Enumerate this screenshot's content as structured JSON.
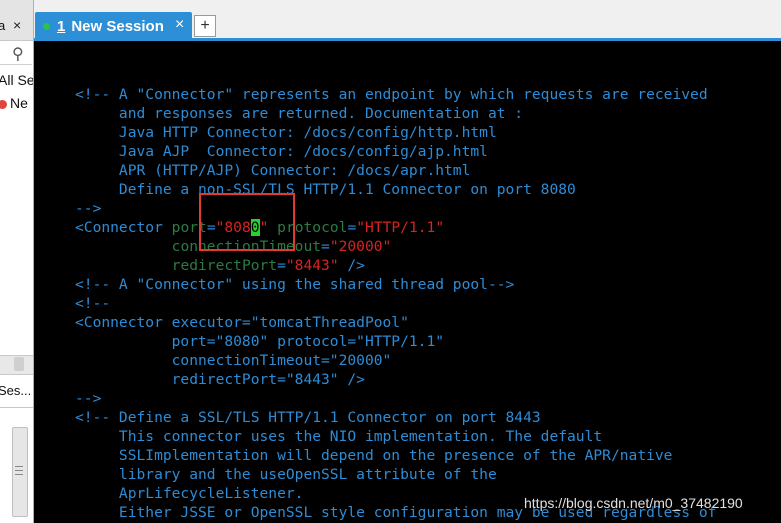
{
  "left_panel": {
    "top_text": "a",
    "close_glyph": "×",
    "items": [
      {
        "label": "All Se"
      },
      {
        "label": "Ne"
      }
    ],
    "sessions_label": "Ses..."
  },
  "tabs": {
    "active": {
      "number": "1",
      "label": "New Session",
      "close_glyph": "×"
    },
    "add_glyph": "+"
  },
  "terminal": {
    "lines": [
      {
        "segments": [
          {
            "cls": "c",
            "text": "<!-- A \"Connector\" represents an endpoint by which requests are received"
          }
        ]
      },
      {
        "segments": [
          {
            "cls": "c",
            "text": "     and responses are returned. Documentation at :"
          }
        ]
      },
      {
        "segments": [
          {
            "cls": "c",
            "text": "     Java HTTP Connector: /docs/config/http.html"
          }
        ]
      },
      {
        "segments": [
          {
            "cls": "c",
            "text": "     Java AJP  Connector: /docs/config/ajp.html"
          }
        ]
      },
      {
        "segments": [
          {
            "cls": "c",
            "text": "     APR (HTTP/AJP) Connector: /docs/apr.html"
          }
        ]
      },
      {
        "segments": [
          {
            "cls": "c",
            "text": "     Define a non-SSL/TLS HTTP/1.1 Connector on port 8080"
          }
        ]
      },
      {
        "segments": [
          {
            "cls": "c",
            "text": "-->"
          }
        ]
      },
      {
        "segments": [
          {
            "cls": "t",
            "text": "<Connector "
          },
          {
            "cls": "a",
            "text": "port"
          },
          {
            "cls": "t",
            "text": "="
          },
          {
            "cls": "v",
            "text": "\"808"
          },
          {
            "cls": "cursor",
            "text": "0"
          },
          {
            "cls": "v",
            "text": "\""
          },
          {
            "cls": "t",
            "text": " "
          },
          {
            "cls": "a",
            "text": "protocol"
          },
          {
            "cls": "t",
            "text": "="
          },
          {
            "cls": "v",
            "text": "\"HTTP/1.1\""
          }
        ]
      },
      {
        "segments": [
          {
            "cls": "t",
            "text": "           "
          },
          {
            "cls": "a",
            "text": "connectionTimeout"
          },
          {
            "cls": "t",
            "text": "="
          },
          {
            "cls": "v",
            "text": "\"20000\""
          }
        ]
      },
      {
        "segments": [
          {
            "cls": "t",
            "text": "           "
          },
          {
            "cls": "a",
            "text": "redirectPort"
          },
          {
            "cls": "t",
            "text": "="
          },
          {
            "cls": "v",
            "text": "\"8443\""
          },
          {
            "cls": "t",
            "text": " />"
          }
        ]
      },
      {
        "segments": [
          {
            "cls": "c",
            "text": "<!-- A \"Connector\" using the shared thread pool-->"
          }
        ]
      },
      {
        "segments": [
          {
            "cls": "c",
            "text": "<!--"
          }
        ]
      },
      {
        "segments": [
          {
            "cls": "c",
            "text": "<Connector executor=\"tomcatThreadPool\""
          }
        ]
      },
      {
        "segments": [
          {
            "cls": "c",
            "text": "           port=\"8080\" protocol=\"HTTP/1.1\""
          }
        ]
      },
      {
        "segments": [
          {
            "cls": "c",
            "text": "           connectionTimeout=\"20000\""
          }
        ]
      },
      {
        "segments": [
          {
            "cls": "c",
            "text": "           redirectPort=\"8443\" />"
          }
        ]
      },
      {
        "segments": [
          {
            "cls": "c",
            "text": "-->"
          }
        ]
      },
      {
        "segments": [
          {
            "cls": "c",
            "text": "<!-- Define a SSL/TLS HTTP/1.1 Connector on port 8443"
          }
        ]
      },
      {
        "segments": [
          {
            "cls": "c",
            "text": "     This connector uses the NIO implementation. The default"
          }
        ]
      },
      {
        "segments": [
          {
            "cls": "c",
            "text": "     SSLImplementation will depend on the presence of the APR/native"
          }
        ]
      },
      {
        "segments": [
          {
            "cls": "c",
            "text": "     library and the useOpenSSL attribute of the"
          }
        ]
      },
      {
        "segments": [
          {
            "cls": "c",
            "text": "     AprLifecycleListener."
          }
        ]
      },
      {
        "segments": [
          {
            "cls": "c",
            "text": "     Either JSSE or OpenSSL style configuration may be used regardless of"
          }
        ]
      }
    ]
  },
  "watermark": "https://blog.csdn.net/m0_37482190",
  "colors": {
    "terminal_bg": "#000000",
    "comment": "#2e8cd6",
    "attribute": "#2d7a44",
    "value": "#d62323",
    "cursor": "#29d12a",
    "tab_active": "#2d8fd5",
    "highlight_box": "#e23a2e"
  }
}
